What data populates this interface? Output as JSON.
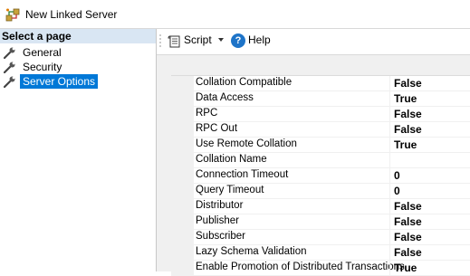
{
  "window": {
    "title": "New Linked Server",
    "icon": "linked-server-icon"
  },
  "sidebar": {
    "header": "Select a page",
    "items": [
      {
        "label": "General",
        "icon": "wrench-icon",
        "selected": false
      },
      {
        "label": "Security",
        "icon": "wrench-icon",
        "selected": false
      },
      {
        "label": "Server Options",
        "icon": "wrench-icon",
        "selected": true
      }
    ]
  },
  "toolbar": {
    "script_label": "Script",
    "help_label": "Help",
    "help_glyph": "?"
  },
  "properties": [
    {
      "name": "Collation Compatible",
      "value": "False"
    },
    {
      "name": "Data Access",
      "value": "True"
    },
    {
      "name": "RPC",
      "value": "False"
    },
    {
      "name": "RPC Out",
      "value": "False"
    },
    {
      "name": "Use Remote Collation",
      "value": "True"
    },
    {
      "name": "Collation Name",
      "value": ""
    },
    {
      "name": "Connection Timeout",
      "value": "0"
    },
    {
      "name": "Query Timeout",
      "value": "0"
    },
    {
      "name": "Distributor",
      "value": "False"
    },
    {
      "name": "Publisher",
      "value": "False"
    },
    {
      "name": "Subscriber",
      "value": "False"
    },
    {
      "name": "Lazy Schema Validation",
      "value": "False"
    },
    {
      "name": "Enable Promotion of Distributed Transactions",
      "value": "True"
    }
  ],
  "colors": {
    "selection": "#0078d7",
    "sidebar_header": "#d9e6f3",
    "help_icon": "#1e74c8"
  }
}
